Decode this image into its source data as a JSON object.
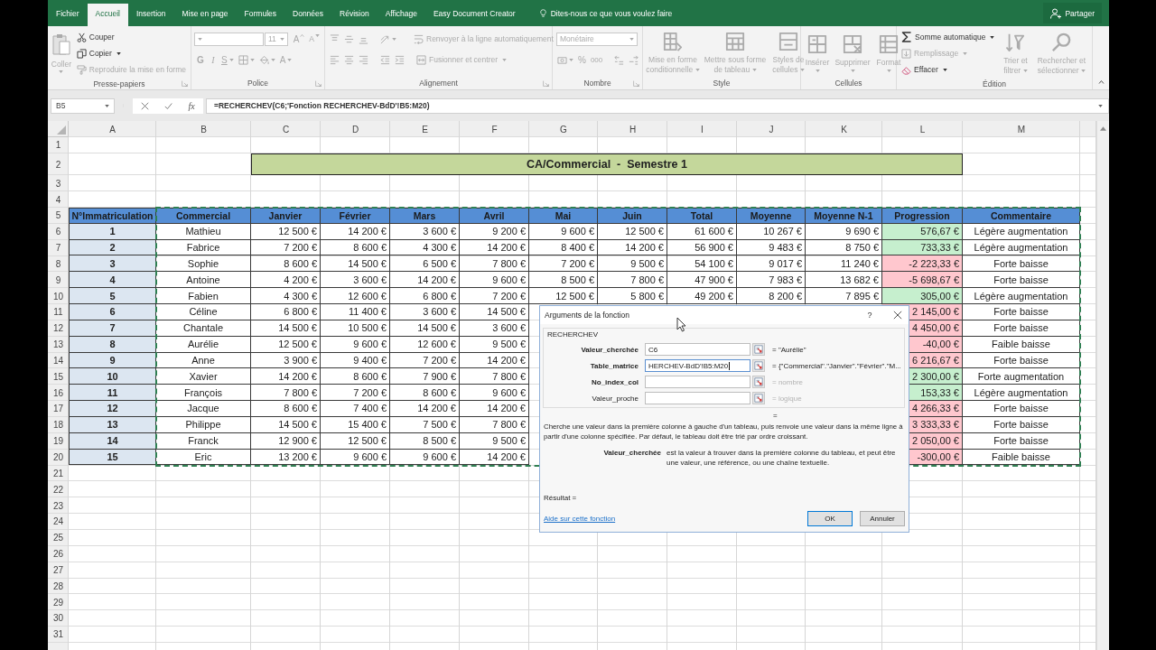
{
  "tabs": [
    {
      "label": "Fichier",
      "selected": false
    },
    {
      "label": "Accueil",
      "selected": true
    },
    {
      "label": "Insertion",
      "selected": false
    },
    {
      "label": "Mise en page",
      "selected": false
    },
    {
      "label": "Formules",
      "selected": false
    },
    {
      "label": "Données",
      "selected": false
    },
    {
      "label": "Révision",
      "selected": false
    },
    {
      "label": "Affichage",
      "selected": false
    },
    {
      "label": "Easy Document Creator",
      "selected": false
    }
  ],
  "tell_me": {
    "placeholder": "Dites-nous ce que vous voulez faire"
  },
  "share": {
    "label": "Partager"
  },
  "ribbon": {
    "clipboard": {
      "label": "Presse-papiers",
      "paste": {
        "label": "Coller",
        "disabled": true
      },
      "cut": {
        "label": "Couper",
        "disabled": false
      },
      "copy": {
        "label": "Copier",
        "disabled": false
      },
      "format_painter": {
        "label": "Reproduire la mise en forme",
        "disabled": true
      }
    },
    "font": {
      "label": "Police",
      "disabled": true,
      "size": "11",
      "grow": "A",
      "shrink": "A",
      "bold": "G",
      "italic": "I",
      "underline": "S",
      "font_color": "A"
    },
    "alignment": {
      "label": "Alignement",
      "disabled": true,
      "wrap_text": "Renvoyer à la ligne automatiquement",
      "merge": "Fusionner et centrer"
    },
    "number": {
      "label": "Nombre",
      "disabled": true,
      "format": "Monétaire",
      "percent": "%",
      "thousands": "000"
    },
    "style": {
      "label": "Style",
      "disabled": true,
      "buttons": [
        "Mise en forme conditionnelle",
        "Mettre sous forme de tableau",
        "Styles de cellules"
      ]
    },
    "cells": {
      "label": "Cellules",
      "disabled": true,
      "buttons": [
        "Insérer",
        "Supprimer",
        "Format"
      ]
    },
    "editing": {
      "label": "Édition",
      "autosum": {
        "label": "Somme automatique",
        "disabled": false
      },
      "fill": {
        "label": "Remplissage",
        "disabled": true
      },
      "clear": {
        "label": "Effacer",
        "disabled": false
      },
      "sort": {
        "label": "Trier et filtrer",
        "disabled": true
      },
      "find": {
        "label": "Rechercher et sélectionner",
        "disabled": true
      }
    }
  },
  "formula_bar": {
    "name_box": "B5",
    "function_label": "fx",
    "formula": "=RECHERCHEV(C6;'Fonction RECHERCHEV-BdD'!B5:M20)"
  },
  "sheet": {
    "columns": [
      "A",
      "B",
      "C",
      "D",
      "E",
      "F",
      "G",
      "H",
      "I",
      "J",
      "K",
      "L",
      "M"
    ],
    "row_numbers": [
      "1",
      "2",
      "3",
      "4",
      "5",
      "6",
      "7",
      "8",
      "9",
      "10",
      "11",
      "12",
      "13",
      "14",
      "15",
      "16",
      "17",
      "18",
      "19",
      "20",
      "21",
      "22",
      "23",
      "24",
      "25",
      "26",
      "27",
      "28",
      "29",
      "30",
      "31"
    ],
    "title": "CA/Commercial  -  Semestre 1",
    "range_marquee": true,
    "headers": [
      "N°Immatriculation",
      "Commercial",
      "Janvier",
      "Février",
      "Mars",
      "Avril",
      "Mai",
      "Juin",
      "Total",
      "Moyenne",
      "Moyenne N-1",
      "Progression",
      "Commentaire"
    ],
    "rows": [
      {
        "cells": [
          "1",
          "Mathieu",
          "12 500 €",
          "14 200 €",
          "3 600 €",
          "9 200 €",
          "9 600 €",
          "12 500 €",
          "61 600 €",
          "10 267 €",
          "9 690 €"
        ],
        "progression": {
          "text": "576,67 €",
          "color": "#c6efce"
        },
        "comment": "Légère augmentation"
      },
      {
        "cells": [
          "2",
          "Fabrice",
          "7 200 €",
          "8 600 €",
          "4 300 €",
          "14 200 €",
          "8 400 €",
          "14 200 €",
          "56 900 €",
          "9 483 €",
          "8 750 €"
        ],
        "progression": {
          "text": "733,33 €",
          "color": "#c6efce"
        },
        "comment": "Légère augmentation"
      },
      {
        "cells": [
          "3",
          "Sophie",
          "8 600 €",
          "14 500 €",
          "6 500 €",
          "7 800 €",
          "7 200 €",
          "9 500 €",
          "54 100 €",
          "9 017 €",
          "11 240 €"
        ],
        "progression": {
          "text": "-2 223,33 €",
          "color": "#ffc7ce"
        },
        "comment": "Forte baisse"
      },
      {
        "cells": [
          "4",
          "Antoine",
          "4 200 €",
          "3 600 €",
          "14 200 €",
          "9 600 €",
          "8 500 €",
          "7 800 €",
          "47 900 €",
          "7 983 €",
          "13 682 €"
        ],
        "progression": {
          "text": "-5 698,67 €",
          "color": "#ffc7ce"
        },
        "comment": "Forte baisse"
      },
      {
        "cells": [
          "5",
          "Fabien",
          "4 300 €",
          "12 600 €",
          "6 800 €",
          "7 200 €",
          "12 500 €",
          "5 800 €",
          "49 200 €",
          "8 200 €",
          "7 895 €"
        ],
        "progression": {
          "text": "305,00 €",
          "color": "#c6efce"
        },
        "comment": "Légère augmentation"
      },
      {
        "cells": [
          "6",
          "Céline",
          "6 800 €",
          "11 400 €",
          "3 600 €",
          "14 500 €"
        ],
        "progression": {
          "text": "2 145,00 €",
          "color": "#ffc7ce"
        },
        "comment": "Forte baisse"
      },
      {
        "cells": [
          "7",
          "Chantale",
          "14 500 €",
          "10 500 €",
          "14 500 €",
          "3 600 €"
        ],
        "progression": {
          "text": "4 450,00 €",
          "color": "#ffc7ce"
        },
        "comment": "Forte baisse"
      },
      {
        "cells": [
          "8",
          "Aurélie",
          "12 500 €",
          "9 600 €",
          "12 600 €",
          "9 500 €"
        ],
        "progression": {
          "text": "-40,00 €",
          "color": "#ffc7ce"
        },
        "comment": "Faible baisse"
      },
      {
        "cells": [
          "9",
          "Anne",
          "3 900 €",
          "9 400 €",
          "7 200 €",
          "14 200 €"
        ],
        "progression": {
          "text": "6 216,67 €",
          "color": "#ffc7ce"
        },
        "comment": "Forte baisse"
      },
      {
        "cells": [
          "10",
          "Xavier",
          "14 200 €",
          "8 600 €",
          "7 900 €",
          "7 800 €"
        ],
        "progression": {
          "text": "2 300,00 €",
          "color": "#c6efce"
        },
        "comment": "Forte augmentation"
      },
      {
        "cells": [
          "11",
          "François",
          "7 800 €",
          "7 200 €",
          "8 600 €",
          "9 600 €"
        ],
        "progression": {
          "text": "153,33 €",
          "color": "#c6efce"
        },
        "comment": "Légère augmentation"
      },
      {
        "cells": [
          "12",
          "Jacque",
          "8 600 €",
          "7 400 €",
          "14 200 €",
          "14 200 €"
        ],
        "progression": {
          "text": "4 266,33 €",
          "color": "#ffc7ce"
        },
        "comment": "Forte baisse"
      },
      {
        "cells": [
          "13",
          "Philippe",
          "14 500 €",
          "15 400 €",
          "7 500 €",
          "7 800 €"
        ],
        "progression": {
          "text": "3 333,33 €",
          "color": "#ffc7ce"
        },
        "comment": "Forte baisse"
      },
      {
        "cells": [
          "14",
          "Franck",
          "12 900 €",
          "12 500 €",
          "8 500 €",
          "9 500 €"
        ],
        "progression": {
          "text": "2 050,00 €",
          "color": "#ffc7ce"
        },
        "comment": "Forte baisse"
      },
      {
        "cells": [
          "15",
          "Eric",
          "13 200 €",
          "9 600 €",
          "9 600 €",
          "14 200 €"
        ],
        "progression": {
          "text": "-300,00 €",
          "color": "#ffc7ce"
        },
        "comment": "Faible baisse"
      }
    ]
  },
  "dialog": {
    "title": "Arguments de la fonction",
    "help": "?",
    "function_name": "RECHERCHEV",
    "arguments": [
      {
        "name": "Valeur_cherchée",
        "required": true,
        "value": "C6",
        "focused": false,
        "result": "= \"Aurélie\""
      },
      {
        "name": "Table_matrice",
        "required": true,
        "value": "HERCHEV-BdD'!B5:M20",
        "focused": true,
        "result": "= {\"Commercial\".\"Janvier\".\"Février\".\"M..."
      },
      {
        "name": "No_index_col",
        "required": true,
        "focused": false,
        "type_hint": "= nombre"
      },
      {
        "name": "Valeur_proche",
        "required": false,
        "focused": false,
        "type_hint": "= logique"
      }
    ],
    "result_equals": "=",
    "description": "Cherche une valeur dans la première colonne à gauche d'un tableau, puis renvoie une valeur dans la même ligne à partir d'une colonne spécifiée. Par défaut, le tableau doit être trié par ordre croissant.",
    "argument_help": {
      "name": "Valeur_cherchée",
      "text": "est la valeur à trouver dans la première colonne du tableau, et peut être une valeur, une référence, ou une chaîne textuelle."
    },
    "result_label": "Résultat =",
    "help_link": "Aide sur cette fonction",
    "buttons": [
      {
        "label": "OK",
        "default": true
      },
      {
        "label": "Annuler",
        "default": false
      }
    ]
  }
}
